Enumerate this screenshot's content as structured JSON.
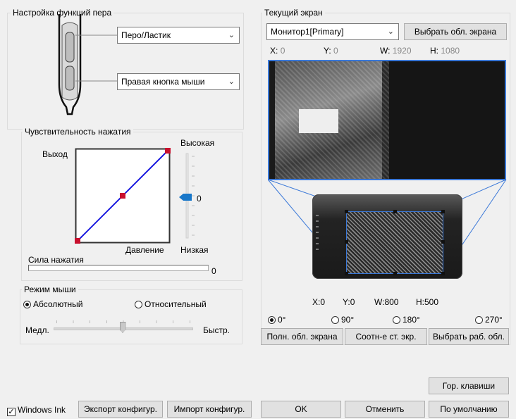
{
  "pen_settings": {
    "group_title": "Настройка функций пера",
    "upper_button": "Перо/Ластик",
    "lower_button": "Правая кнопка мыши"
  },
  "pressure": {
    "group_title": "Чувствительность нажатия",
    "output_label": "Выход",
    "high_label": "Высокая",
    "low_label": "Низкая",
    "pressure_axis_label": "Давление",
    "sensitivity_value": "0",
    "force_label": "Сила нажатия",
    "force_value": "0"
  },
  "mouse_mode": {
    "group_title": "Режим мыши",
    "absolute": "Абсолютный",
    "relative": "Относительный",
    "slow": "Медл.",
    "fast": "Быстр.",
    "speed_fraction": 0.5
  },
  "screen": {
    "group_title": "Текущий экран",
    "monitor": "Монитор1[Primary]",
    "select_area": "Выбрать обл. экрана",
    "x_label": "X:",
    "x_value": "0",
    "y_label": "Y:",
    "y_value": "0",
    "w_label": "W:",
    "w_value": "1920",
    "h_label": "H:",
    "h_value": "1080"
  },
  "tablet": {
    "x_label": "X:",
    "x_value": "0",
    "y_label": "Y:",
    "y_value": "0",
    "w_label": "W:",
    "w_value": "800",
    "h_label": "H:",
    "h_value": "500"
  },
  "rotation": {
    "r0": "0°",
    "r90": "90°",
    "r180": "180°",
    "r270": "270°"
  },
  "area_buttons": {
    "full": "Полн. обл. экрана",
    "ratio": "Соотн-е ст. экр.",
    "select_work": "Выбрать раб. обл."
  },
  "hotkeys": "Гор. клавиши",
  "footer": {
    "windows_ink": "Windows Ink",
    "checkmark": "✓",
    "export": "Экспорт конфигур.",
    "import": "Импорт конфигур.",
    "ok": "OK",
    "cancel": "Отменить",
    "default": "По умолчанию"
  },
  "colors": {
    "curve": "#1a1adf",
    "handle": "#c8102e",
    "slider_thumb": "#1877c9",
    "mapping_line": "#3a78d8"
  }
}
